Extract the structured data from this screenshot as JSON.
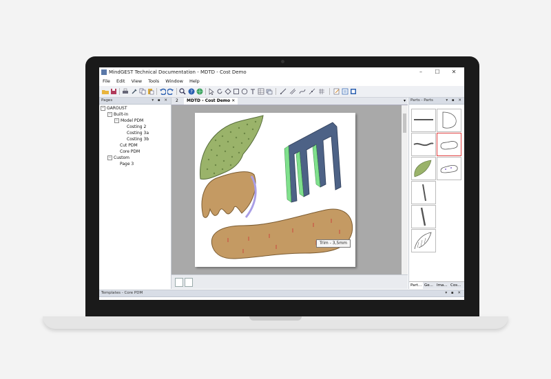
{
  "window": {
    "title": "MindGEST Technical Documentation - MDTD - Cost Demo",
    "controls": [
      "–",
      "☐",
      "✕"
    ]
  },
  "menu": {
    "file": "File",
    "edit": "Edit",
    "view": "View",
    "tools": "Tools",
    "window": "Window",
    "help": "Help"
  },
  "toolbar": {
    "buttons": [
      "open-folder-icon",
      "save-icon",
      "print-icon",
      "settings-icon",
      "copy-icon",
      "paste-icon",
      "undo-icon",
      "redo-icon",
      "search-icon",
      "help-icon",
      "globe-icon",
      "pointer-icon",
      "rotate-icon",
      "node-icon",
      "rectangle-icon",
      "circle-icon",
      "text-icon",
      "table-icon",
      "layers-icon",
      "measure-icon",
      "cut-icon",
      "curve-icon",
      "grid-icon",
      "edit-doc-icon",
      "clipboard-icon",
      "properties-icon"
    ]
  },
  "pages": {
    "header": "Pages",
    "root": "GAROUST",
    "built_in": "Built-In",
    "model_pdm": "Model PDM",
    "costing2": "Costing 2",
    "costing3a": "Costing 3a",
    "costing3b": "Costing 3b",
    "cut_pdm": "Cut PDM",
    "core_pdm": "Core PDM",
    "custom": "Custom",
    "page3": "Page 3"
  },
  "doc": {
    "tab_number": "2",
    "tab_title": "MDTD - Cost Demo",
    "tooltip": "Trim - 3,5mm"
  },
  "parts": {
    "header": "Parts - Parts",
    "tabs": [
      "Part...",
      "Ge...",
      "Ima...",
      "Cos..."
    ]
  },
  "templates": {
    "header": "Templates - Core PDM"
  },
  "colors": {
    "leaf_green": "#9ab36a",
    "leather_brown": "#c49a63",
    "trim_purple": "#a99ee6",
    "frame_blue": "#4d6286",
    "frame_green": "#7fe08c",
    "selection_red": "#e04040"
  }
}
